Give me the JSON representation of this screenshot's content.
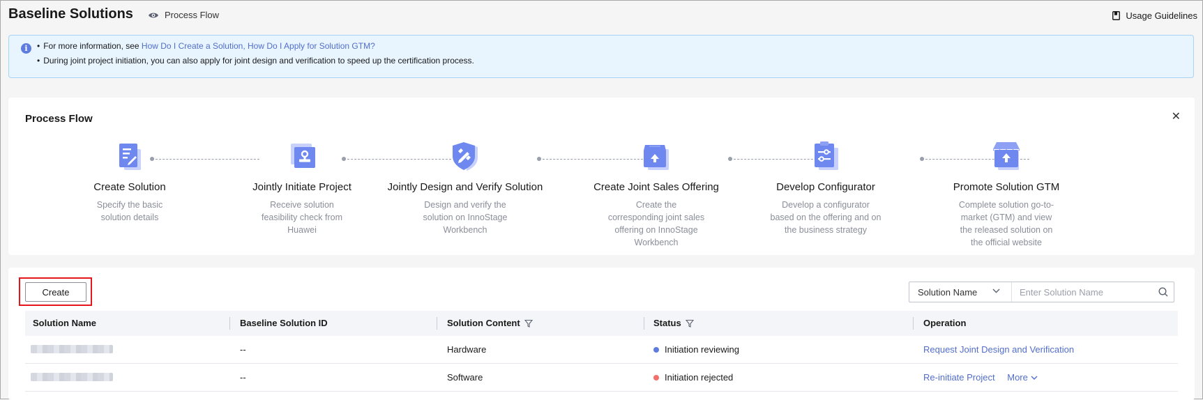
{
  "header": {
    "title": "Baseline Solutions",
    "process_flow_link": "Process Flow",
    "usage_guidelines": "Usage Guidelines"
  },
  "notice": {
    "line1_prefix": "For more information, see ",
    "line1_link": "How Do I Create a Solution, How Do I Apply for Solution GTM?",
    "line2": "During joint project initiation, you can also apply for joint design and verification to speed up the certification process."
  },
  "process_flow": {
    "title": "Process Flow",
    "steps": [
      {
        "title": "Create Solution",
        "description": "Specify the basic solution details",
        "icon": "document-edit-icon"
      },
      {
        "title": "Jointly Initiate Project",
        "description": "Receive solution feasibility check from Huawei",
        "icon": "stamp-icon"
      },
      {
        "title": "Jointly Design and Verify Solution",
        "description": "Design and verify the solution on InnoStage Workbench",
        "icon": "shield-tools-icon"
      },
      {
        "title": "Create Joint Sales Offering",
        "description": "Create the corresponding joint sales offering on InnoStage Workbench",
        "icon": "box-upload-icon"
      },
      {
        "title": "Develop Configurator",
        "description": "Develop a configurator based on the offering and on the business strategy",
        "icon": "clipboard-sliders-icon"
      },
      {
        "title": "Promote Solution GTM",
        "description": "Complete solution go-to-market (GTM) and view the released solution on the official website",
        "icon": "store-upload-icon"
      }
    ]
  },
  "toolbar": {
    "create_label": "Create",
    "search_field": "Solution Name",
    "search_placeholder": "Enter Solution Name"
  },
  "table": {
    "columns": [
      "Solution Name",
      "Baseline Solution ID",
      "Solution Content",
      "Status",
      "Operation"
    ],
    "rows": [
      {
        "name": "",
        "id": "--",
        "content": "Hardware",
        "status": "Initiation reviewing",
        "status_color": "#5e7ce0",
        "operations": [
          "Request Joint Design and Verification"
        ]
      },
      {
        "name": "",
        "id": "--",
        "content": "Software",
        "status": "Initiation rejected",
        "status_color": "#f66f6a",
        "operations": [
          "Re-initiate Project",
          "More"
        ]
      }
    ]
  },
  "colors": {
    "accent": "#526ecc",
    "icon_primary": "#6f88f0",
    "icon_shadow": "#c7d1fb",
    "highlight_border": "#e5161b"
  }
}
